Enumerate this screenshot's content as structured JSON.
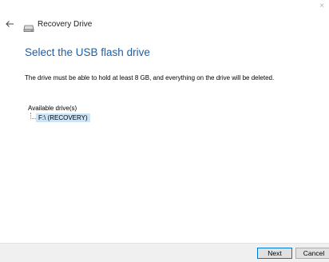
{
  "window": {
    "title": "Recovery Drive",
    "close_label": "×"
  },
  "page": {
    "heading": "Select the USB flash drive",
    "description": "The drive must be able to hold at least 8 GB, and everything on the drive will be deleted.",
    "drives_label": "Available drive(s)",
    "drives": [
      {
        "label": "F:\\ (RECOVERY)",
        "selected": true
      }
    ]
  },
  "footer": {
    "next_label": "Next",
    "cancel_label": "Cancel"
  },
  "colors": {
    "heading": "#1c5fa8",
    "selection": "#cce4f7",
    "footer_bg": "#f0f0f0"
  },
  "icons": {
    "back": "back-arrow-icon",
    "drive": "drive-icon"
  }
}
